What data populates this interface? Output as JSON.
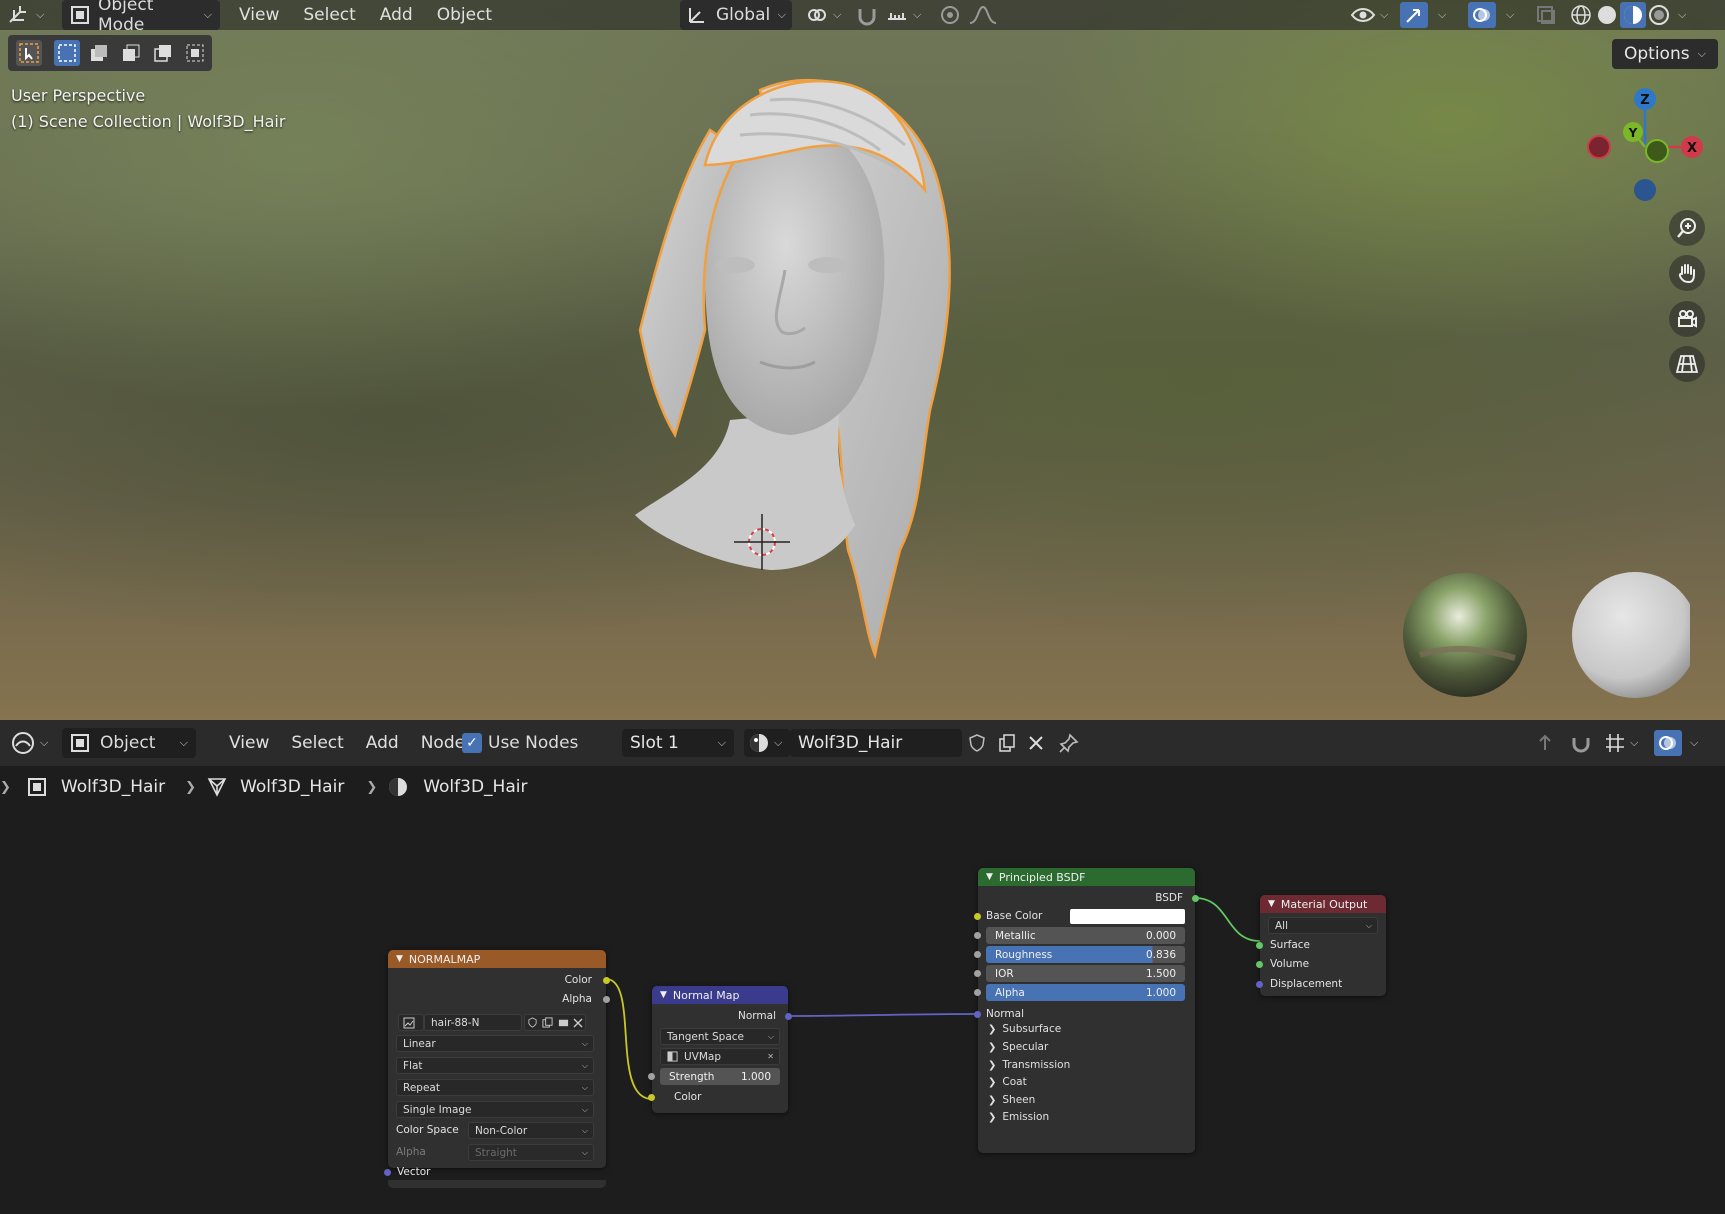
{
  "viewport": {
    "header": {
      "mode_label": "Object Mode",
      "menus": [
        "View",
        "Select",
        "Add",
        "Object"
      ],
      "orientation_label": "Global"
    },
    "options_label": "Options",
    "overlay": {
      "view_name": "User Perspective",
      "collection": "(1) Scene Collection | Wolf3D_Hair"
    },
    "gizmo": {
      "z": "Z",
      "y": "Y",
      "x": "X"
    },
    "colors": {
      "selection_outline": "#f0a040",
      "z_axis": "#2f78c8",
      "x_axis": "#d03a4a",
      "y_axis": "#7ab828"
    }
  },
  "node_editor": {
    "header": {
      "editor_type": "Object",
      "menus": [
        "View",
        "Select",
        "Add",
        "Node"
      ],
      "use_nodes_label": "Use Nodes",
      "use_nodes_checked": true,
      "slot": "Slot 1",
      "material_name": "Wolf3D_Hair"
    },
    "breadcrumbs": [
      "Wolf3D_Hair",
      "Wolf3D_Hair",
      "Wolf3D_Hair"
    ],
    "nodes": {
      "image": {
        "title": "NORMALMAP",
        "outputs": [
          "Color",
          "Alpha"
        ],
        "image_name": "hair-88-N",
        "interpolation": "Linear",
        "projection": "Flat",
        "extension": "Repeat",
        "source": "Single Image",
        "color_space_label": "Color Space",
        "color_space": "Non-Color",
        "alpha_label": "Alpha",
        "alpha_mode": "Straight",
        "input": "Vector"
      },
      "normal_map": {
        "title": "Normal Map",
        "output": "Normal",
        "space": "Tangent Space",
        "uv_map": "UVMap",
        "strength_label": "Strength",
        "strength_value": "1.000",
        "input": "Color"
      },
      "principled": {
        "title": "Principled BSDF",
        "output": "BSDF",
        "base_color_label": "Base Color",
        "base_color": "#ffffff",
        "metallic_label": "Metallic",
        "metallic": "0.000",
        "roughness_label": "Roughness",
        "roughness": "0.836",
        "ior_label": "IOR",
        "ior": "1.500",
        "alpha_label": "Alpha",
        "alpha": "1.000",
        "normal_label": "Normal",
        "panels": [
          "Subsurface",
          "Specular",
          "Transmission",
          "Coat",
          "Sheen",
          "Emission"
        ]
      },
      "output": {
        "title": "Material Output",
        "target": "All",
        "inputs": [
          "Surface",
          "Volume",
          "Displacement"
        ]
      }
    },
    "colors": {
      "image_header": "#9a5a27",
      "normal_map_header": "#3b3b8e",
      "principled_header": "#2c6b30",
      "output_header": "#6d2a33"
    }
  }
}
